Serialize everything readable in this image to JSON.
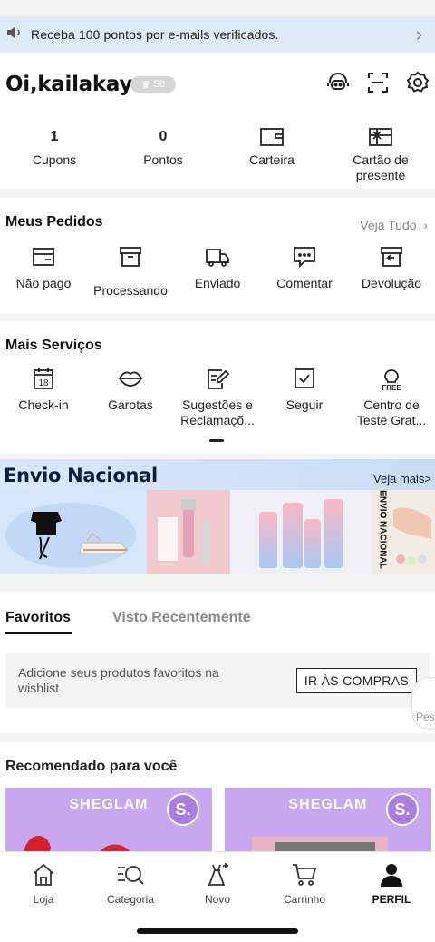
{
  "notice": {
    "message": "Receba 100 pontos por e-mails verificados.",
    "icon": "speaker-icon"
  },
  "profile": {
    "greeting": "Oi,kailakayc",
    "level": "S0",
    "stats": [
      {
        "value": "1",
        "label": "Cupons"
      },
      {
        "value": "0",
        "label": "Pontos"
      },
      {
        "icon": "wallet-icon",
        "label": "Carteira"
      },
      {
        "icon": "gift-card-icon",
        "label": "Cartão de presente"
      }
    ]
  },
  "orders": {
    "title": "Meus Pedidos",
    "see_all": "Veja Tudo",
    "items": [
      {
        "label": "Não pago",
        "icon": "unpaid-icon"
      },
      {
        "label": "Processando",
        "icon": "processing-icon"
      },
      {
        "label": "Enviado",
        "icon": "truck-icon"
      },
      {
        "label": "Comentar",
        "icon": "comment-icon"
      },
      {
        "label": "Devolução",
        "icon": "return-icon"
      }
    ]
  },
  "services": {
    "title": "Mais Serviços",
    "items": [
      {
        "label": "Check-in",
        "icon": "calendar-icon",
        "icon_text": "18"
      },
      {
        "label": "Garotas",
        "icon": "lips-icon"
      },
      {
        "label": "Sugestões e Reclamaçõ...",
        "icon": "feedback-icon"
      },
      {
        "label": "Seguir",
        "icon": "follow-icon"
      },
      {
        "label": "Centro de Teste Grat...",
        "icon": "free-trial-icon",
        "icon_text": "FREE"
      }
    ]
  },
  "banner": {
    "title": "Envio Nacional",
    "more": "Veja mais>",
    "side_text": "ENVIO NACIONAL"
  },
  "favorites": {
    "tabs": [
      "Favoritos",
      "Visto Recentemente"
    ],
    "empty_text": "Adicione seus produtos favoritos na wishlist",
    "button": "IR ÀS COMPRAS",
    "floater": "Pes"
  },
  "recommended": {
    "title": "Recomendado para você",
    "cards": [
      {
        "brand": "SHEGLAM",
        "badge": "S."
      },
      {
        "brand": "SHEGLAM",
        "badge": "S."
      }
    ]
  },
  "tabbar": [
    {
      "label": "Loja",
      "icon": "home-icon"
    },
    {
      "label": "Categoria",
      "icon": "category-search-icon"
    },
    {
      "label": "Novo",
      "icon": "new-dress-icon"
    },
    {
      "label": "Carrinho",
      "icon": "cart-icon"
    },
    {
      "label": "PERFIL",
      "icon": "profile-icon",
      "active": true
    }
  ],
  "colors": {
    "notice_bg": "#dfeaf8",
    "banner_title": "#0c1e3e",
    "card_purple": "#c8a6f0"
  }
}
